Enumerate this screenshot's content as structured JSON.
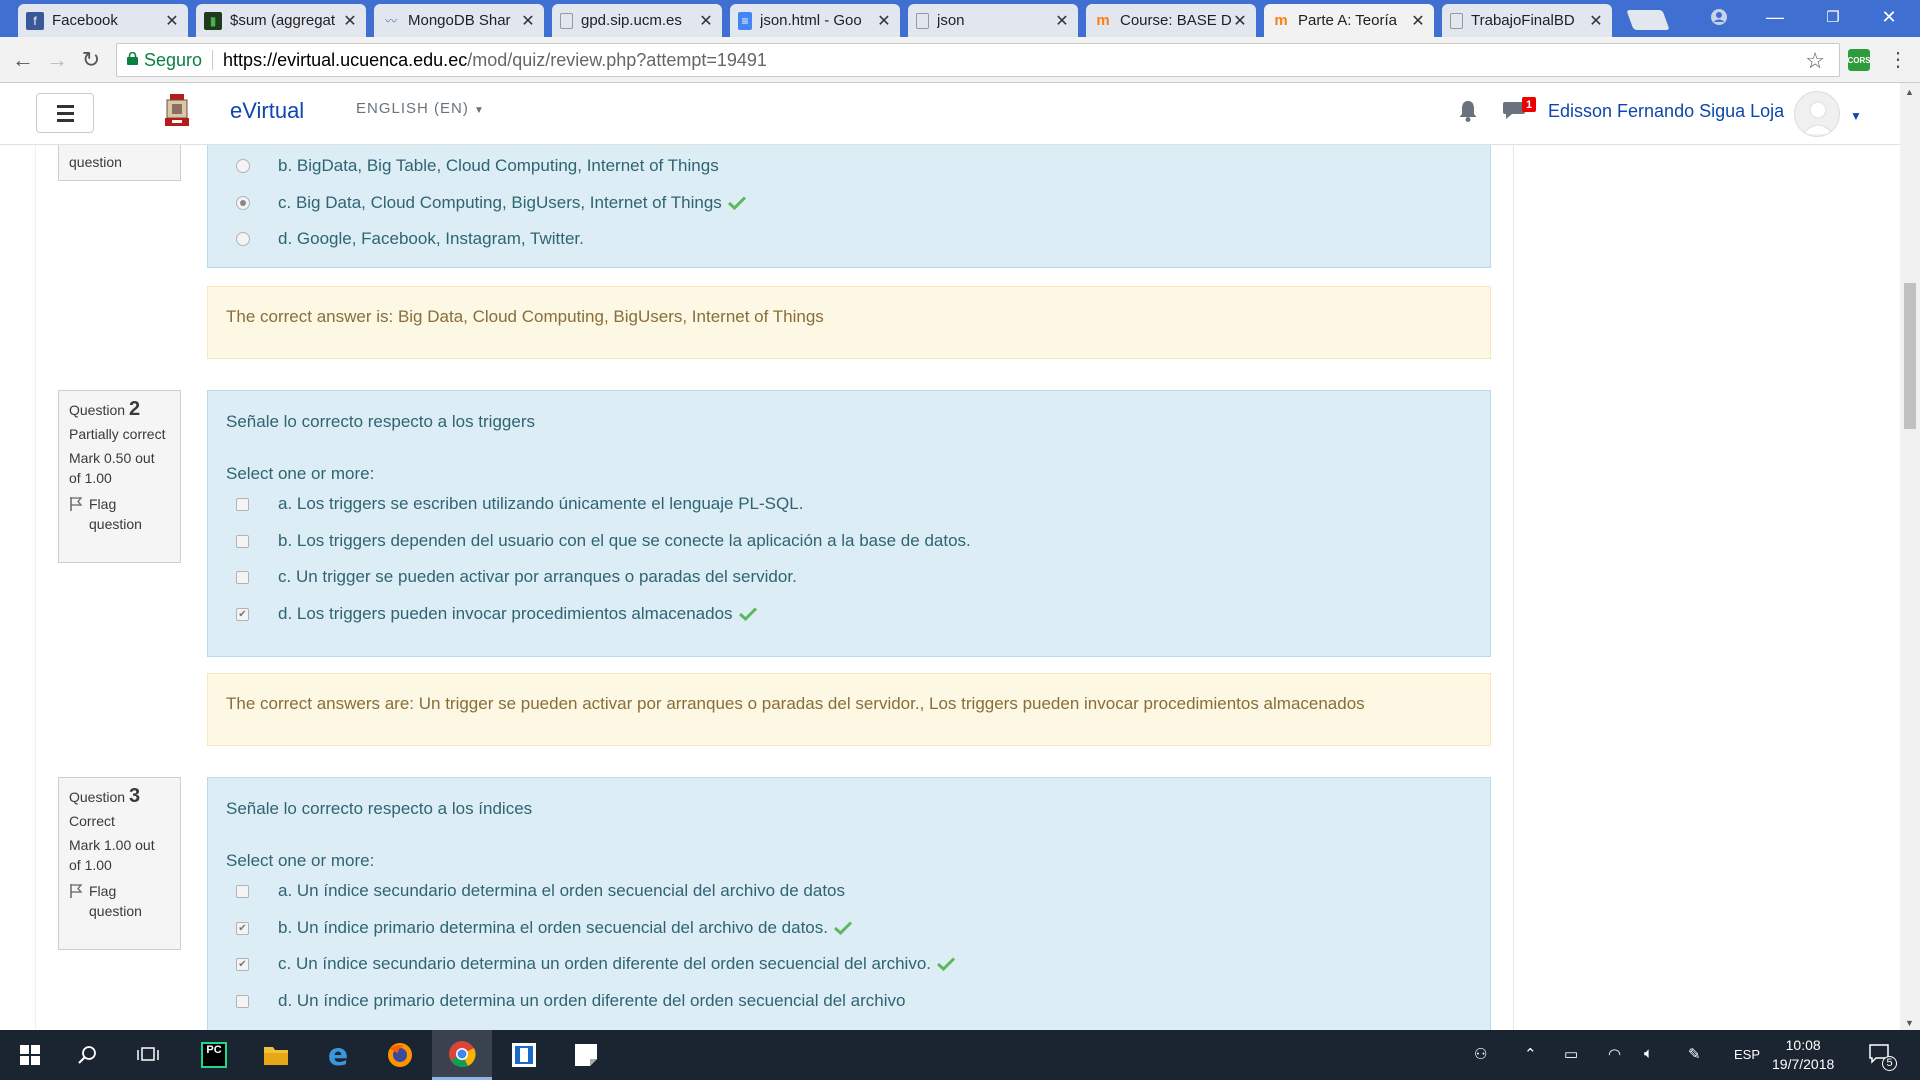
{
  "browser": {
    "tabs": [
      {
        "label": "Facebook",
        "icon": "facebook-icon",
        "color": "#3b5998"
      },
      {
        "label": "$sum (aggregat",
        "icon": "mongodb-leaf-icon",
        "color": "#2a7d2a"
      },
      {
        "label": "MongoDB Shar",
        "icon": "mongodb-icon",
        "color": "#5b7fb8"
      },
      {
        "label": "gpd.sip.ucm.es",
        "icon": "page-icon",
        "color": "#888"
      },
      {
        "label": "json.html - Goo",
        "icon": "google-docs-icon",
        "color": "#4285f4"
      },
      {
        "label": "json",
        "icon": "page-icon",
        "color": "#888"
      },
      {
        "label": "Course: BASE D",
        "icon": "moodle-icon",
        "color": "#f98012"
      },
      {
        "label": "Parte A: Teoría",
        "icon": "moodle-icon",
        "color": "#f98012"
      },
      {
        "label": "TrabajoFinalBD",
        "icon": "page-icon",
        "color": "#888"
      }
    ],
    "address": {
      "secure_label": "Seguro",
      "url_host": "https://evirtual.ucuenca.edu.ec",
      "url_path": "/mod/quiz/review.php?attempt=19491"
    },
    "extension_label": "CORS"
  },
  "header": {
    "brand": "eVirtual",
    "language": "ENGLISH (EN)",
    "notification_count": "1",
    "username": "Edisson Fernando Sigua Loja"
  },
  "questions": {
    "q1": {
      "flag_tail": "question",
      "options": [
        {
          "text": "b. BigData, Big Table, Cloud Computing, Internet of Things",
          "checked": false,
          "correct": false
        },
        {
          "text": "c. Big Data, Cloud Computing, BigUsers, Internet of Things",
          "checked": true,
          "correct": true
        },
        {
          "text": "d. Google, Facebook, Instagram, Twitter.",
          "checked": false,
          "correct": false
        }
      ],
      "feedback": "The correct answer is: Big Data, Cloud Computing, BigUsers, Internet of Things"
    },
    "q2": {
      "label": "Question",
      "number": "2",
      "state": "Partially correct",
      "grade": "Mark 0.50 out of 1.00",
      "flag": "Flag question",
      "text": "Señale lo correcto respecto a los triggers",
      "prompt": "Select one or more:",
      "options": [
        {
          "text": "a. Los triggers se escriben utilizando únicamente el lenguaje PL-SQL.",
          "checked": false,
          "correct": false
        },
        {
          "text": "b. Los triggers dependen del usuario con el que se conecte la aplicación a la base de datos.",
          "checked": false,
          "correct": false
        },
        {
          "text": "c. Un trigger se pueden activar por arranques o paradas del servidor.",
          "checked": false,
          "correct": false
        },
        {
          "text": "d. Los triggers pueden invocar procedimientos almacenados",
          "checked": true,
          "correct": true
        }
      ],
      "feedback": "The correct answers are: Un trigger se pueden activar por arranques o paradas del servidor., Los triggers pueden invocar procedimientos almacenados"
    },
    "q3": {
      "label": "Question",
      "number": "3",
      "state": "Correct",
      "grade": "Mark 1.00 out of 1.00",
      "flag": "Flag question",
      "text": "Señale lo correcto respecto a los índices",
      "prompt": "Select one or more:",
      "options": [
        {
          "text": "a. Un índice secundario determina el orden secuencial del archivo de datos",
          "checked": false,
          "correct": false
        },
        {
          "text": "b. Un índice primario determina el orden secuencial del archivo de datos.",
          "checked": true,
          "correct": true
        },
        {
          "text": "c. Un índice secundario determina un orden diferente del orden secuencial del archivo.",
          "checked": true,
          "correct": true
        },
        {
          "text": "d. Un índice primario determina un orden diferente del orden secuencial del archivo",
          "checked": false,
          "correct": false
        }
      ]
    }
  },
  "taskbar": {
    "language": "ESP",
    "time": "10:08",
    "date": "19/7/2018",
    "notifications": "5"
  },
  "colors": {
    "link": "#0f47ad",
    "check_green": "#5cb85c",
    "formulation_bg": "#dcedf5",
    "feedback_bg": "#fcf8e3"
  }
}
